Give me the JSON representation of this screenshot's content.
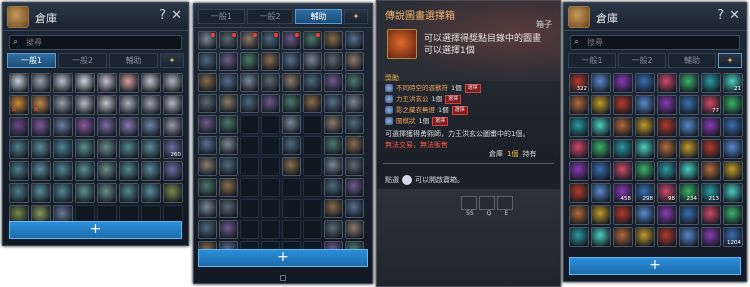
{
  "colors": {
    "panel_bg": "#121924",
    "accent_blue": "#2b8ed8",
    "title_orange": "#f1b36a",
    "reward_name": "#f0a45a",
    "warning_red": "#ff5544",
    "count_gold": "#f2c14b"
  },
  "panel1": {
    "title": "倉庫",
    "help": "?",
    "close": "✕",
    "search_placeholder": "搜尋",
    "tabs": [
      "一般1",
      "一般2",
      "輔助"
    ],
    "tab_icon": "✦",
    "add": "+",
    "quantities": {
      "r4c8": "260"
    }
  },
  "panel2": {
    "tabs": [
      "一般1",
      "一般2",
      "輔助"
    ],
    "tab_icon": "✦",
    "add": "+"
  },
  "panel3": {
    "title": "傳說圖畫選擇箱",
    "close": "箱子",
    "desc_line1": "可以選擇得獎點目錄中的圖畫",
    "desc_line2": "可以選擇1個",
    "section": "獎勵",
    "rewards": [
      {
        "name": "不同時空的遊獸符",
        "count": "1個",
        "btn": "選擇"
      },
      {
        "name": "力王洪玄公",
        "count": "1個",
        "btn": "選擇"
      },
      {
        "name": "影之藏衣無燈",
        "count": "1個",
        "btn": "選擇"
      },
      {
        "name": "圍棋狀",
        "count": "1個",
        "btn": "選擇"
      }
    ],
    "note1": "可選擇獲得勇熙師，力王洪玄公圖畫中的1個。",
    "note2": "無法交易，無法販售",
    "owned_label": "倉庫",
    "owned_value": "1個",
    "owned_suffix": "持有",
    "hint_prefix": "點選",
    "hint_suffix": "可以開啟寶箱。",
    "skill_labels": [
      "SS",
      "Q",
      "E"
    ]
  },
  "panel4": {
    "title": "倉庫",
    "help": "?",
    "close": "✕",
    "search_placeholder": "搜尋",
    "tabs": [
      "一般1",
      "一般2",
      "輔助"
    ],
    "tab_icon": "✦",
    "add": "+",
    "quantities": [
      "322",
      "21",
      "77",
      "458",
      "298",
      "98",
      "234",
      "213",
      "1204"
    ]
  }
}
